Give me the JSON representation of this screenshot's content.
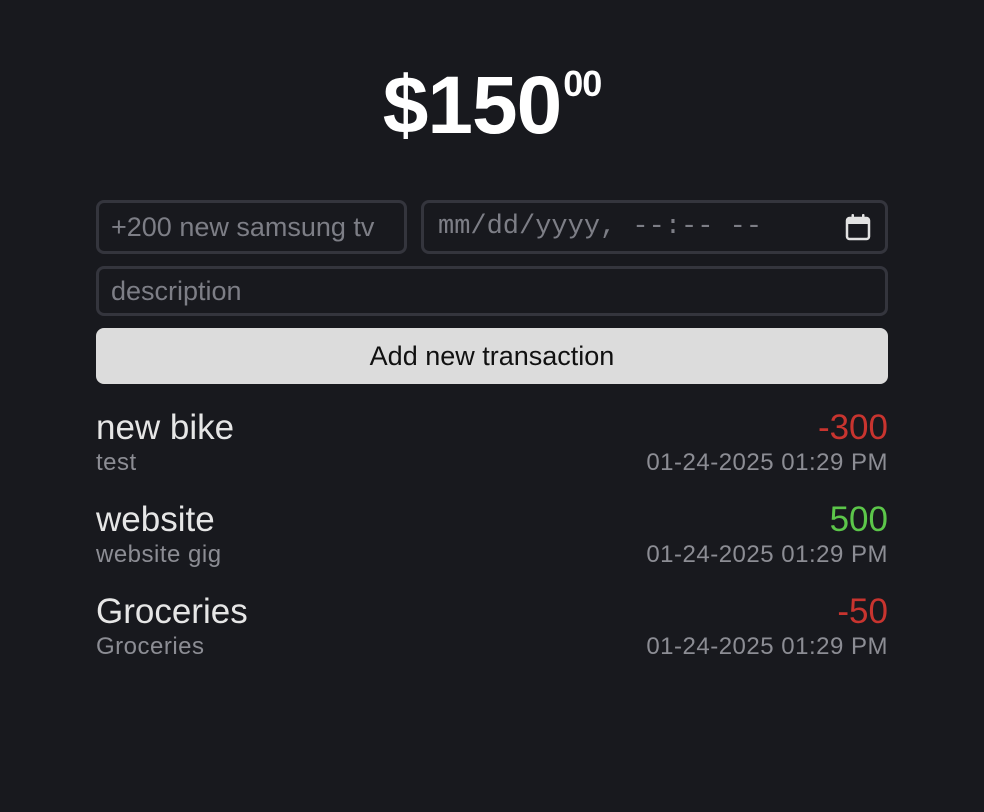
{
  "balance": {
    "dollars": "$150",
    "cents": "00"
  },
  "form": {
    "amount_placeholder": "+200 new samsung tv",
    "datetime_placeholder": "mm/dd/yyyy, --:-- --",
    "description_placeholder": "description",
    "add_button_label": "Add new transaction",
    "calendar_icon": "calendar-icon"
  },
  "colors": {
    "negative": "#c8342f",
    "positive": "#5cc64a",
    "background": "#18191e",
    "button": "#dcdcdc"
  },
  "transactions": [
    {
      "name": "new bike",
      "description": "test",
      "amount": "-300",
      "datetime": "01-24-2025 01:29 PM",
      "sign": "negative"
    },
    {
      "name": "website",
      "description": "website gig",
      "amount": "500",
      "datetime": "01-24-2025 01:29 PM",
      "sign": "positive"
    },
    {
      "name": "Groceries",
      "description": "Groceries",
      "amount": "-50",
      "datetime": "01-24-2025 01:29 PM",
      "sign": "negative"
    }
  ]
}
